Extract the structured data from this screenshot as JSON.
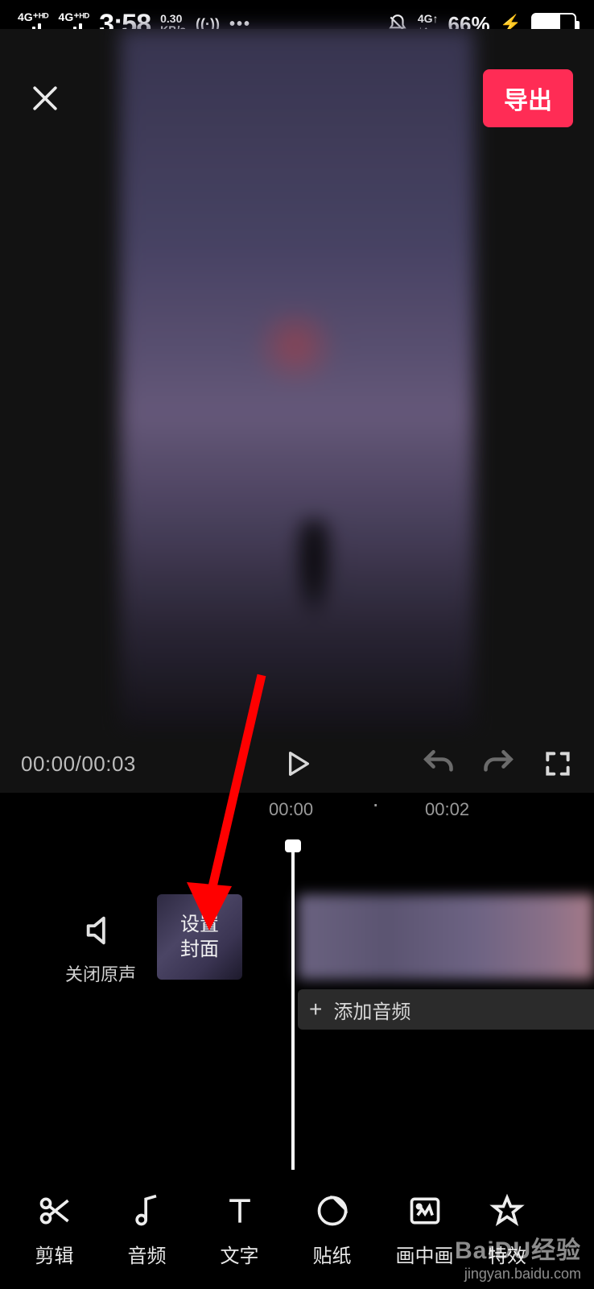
{
  "statusbar": {
    "sig1": "4G⁺ᴴᴰ",
    "sig2": "4G⁺ᴴᴰ",
    "time": "3:58",
    "net_top": "0.30",
    "net_bottom": "KB/s",
    "wifi": "((·))",
    "dots": "•••",
    "net2_top": "4G↑",
    "net2_bottom": "↓↑",
    "battery_pct": "66%",
    "bolt": "⚡"
  },
  "header": {
    "export_label": "导出"
  },
  "playback": {
    "current": "00:00",
    "total": "00:03"
  },
  "ruler": {
    "t0": "00:00",
    "dot": "·",
    "t2": "00:02"
  },
  "timeline": {
    "mute_label": "关闭原声",
    "cover_label_l1": "设置",
    "cover_label_l2": "封面",
    "add_audio_plus": "+",
    "add_audio_label": "添加音频"
  },
  "toolbar": {
    "items": [
      {
        "label": "剪辑"
      },
      {
        "label": "音频"
      },
      {
        "label": "文字"
      },
      {
        "label": "贴纸"
      },
      {
        "label": "画中画"
      },
      {
        "label": "特效"
      }
    ]
  },
  "watermark": {
    "line1": "BaiDU经验",
    "line2": "jingyan.baidu.com"
  }
}
